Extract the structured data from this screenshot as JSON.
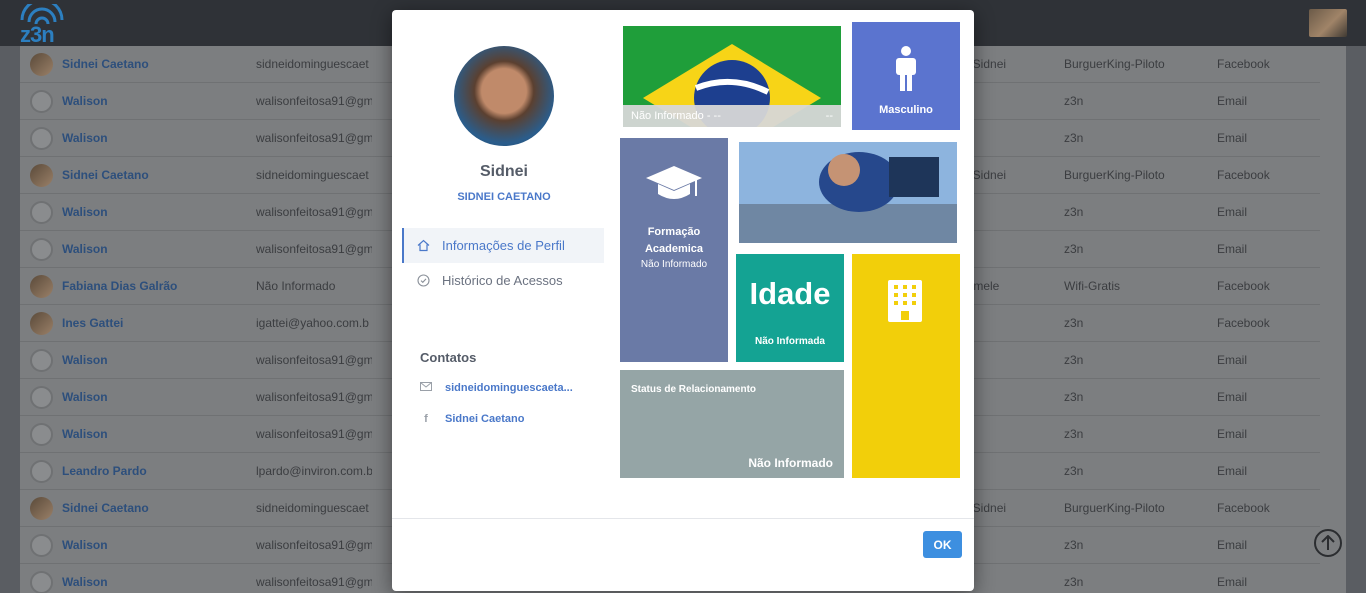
{
  "app": {
    "logo_text": "z3n"
  },
  "rows": [
    {
      "name": "Sidnei Caetano",
      "email": "sidneidominguescaet",
      "c3": "el Sidnei",
      "c4": "BurguerKing-Piloto",
      "c5": "Facebook"
    },
    {
      "name": "Walison",
      "email": "walisonfeitosa91@gm",
      "c3": "",
      "c4": "z3n",
      "c5": "Email"
    },
    {
      "name": "Walison",
      "email": "walisonfeitosa91@gm",
      "c3": "",
      "c4": "z3n",
      "c5": "Email"
    },
    {
      "name": "Sidnei Caetano",
      "email": "sidneidominguescaet",
      "c3": "el Sidnei",
      "c4": "BurguerKing-Piloto",
      "c5": "Facebook"
    },
    {
      "name": "Walison",
      "email": "walisonfeitosa91@gm",
      "c3": "",
      "c4": "z3n",
      "c5": "Email"
    },
    {
      "name": "Walison",
      "email": "walisonfeitosa91@gm",
      "c3": "",
      "c4": "z3n",
      "c5": "Email"
    },
    {
      "name": "Fabiana Dias Galrão",
      "email": "Não Informado",
      "c3": "gamele",
      "c4": "Wifi-Gratis",
      "c5": "Facebook"
    },
    {
      "name": "Ines Gattei",
      "email": "igattei@yahoo.com.b",
      "c3": "",
      "c4": "z3n",
      "c5": "Facebook"
    },
    {
      "name": "Walison",
      "email": "walisonfeitosa91@gm",
      "c3": "",
      "c4": "z3n",
      "c5": "Email"
    },
    {
      "name": "Walison",
      "email": "walisonfeitosa91@gm",
      "c3": "",
      "c4": "z3n",
      "c5": "Email"
    },
    {
      "name": "Walison",
      "email": "walisonfeitosa91@gm",
      "c3": "",
      "c4": "z3n",
      "c5": "Email"
    },
    {
      "name": "Leandro Pardo",
      "email": "lpardo@inviron.com.b",
      "c3": "",
      "c4": "z3n",
      "c5": "Email"
    },
    {
      "name": "Sidnei Caetano",
      "email": "sidneidominguescaet",
      "c3": "el Sidnei",
      "c4": "BurguerKing-Piloto",
      "c5": "Facebook"
    },
    {
      "name": "Walison",
      "email": "walisonfeitosa91@gm",
      "c3": "",
      "c4": "z3n",
      "c5": "Email"
    },
    {
      "name": "Walison",
      "email": "walisonfeitosa91@gm",
      "c3": "",
      "c4": "z3n",
      "c5": "Email"
    }
  ],
  "profile": {
    "name": "Sidnei",
    "full_name": "SIDNEI CAETANO",
    "nav": [
      {
        "label": "Informações de Perfil",
        "icon": "home-icon",
        "active": true
      },
      {
        "label": "Histórico de Acessos",
        "icon": "check-circle-icon",
        "active": false
      }
    ],
    "contacts_title": "Contatos",
    "contacts": [
      {
        "icon": "envelope-icon",
        "value": "sidneidominguescaeta..."
      },
      {
        "icon": "facebook-icon",
        "value": "Sidnei Caetano"
      }
    ]
  },
  "tiles": {
    "location": {
      "label": "Não Informado - --",
      "right": "--"
    },
    "gender": {
      "label": "Masculino",
      "icon": "male-person-icon"
    },
    "education": {
      "title": "Formação Academica",
      "value": "Não Informado",
      "icon": "graduation-cap-icon"
    },
    "age": {
      "title": "Idade",
      "value": "Não Informada"
    },
    "building": {
      "icon": "building-icon"
    },
    "relationship": {
      "title": "Status de Relacionamento",
      "value": "Não Informado"
    }
  },
  "footer": {
    "ok_label": "OK"
  },
  "colors": {
    "accent": "#4a78c9",
    "ok_button": "#3d8fe0",
    "gender_tile": "#5b74cf",
    "education_tile": "#6a7aa6",
    "age_tile": "#14a393",
    "building_tile": "#f2cf0a",
    "relationship_tile": "#95a5a6"
  }
}
